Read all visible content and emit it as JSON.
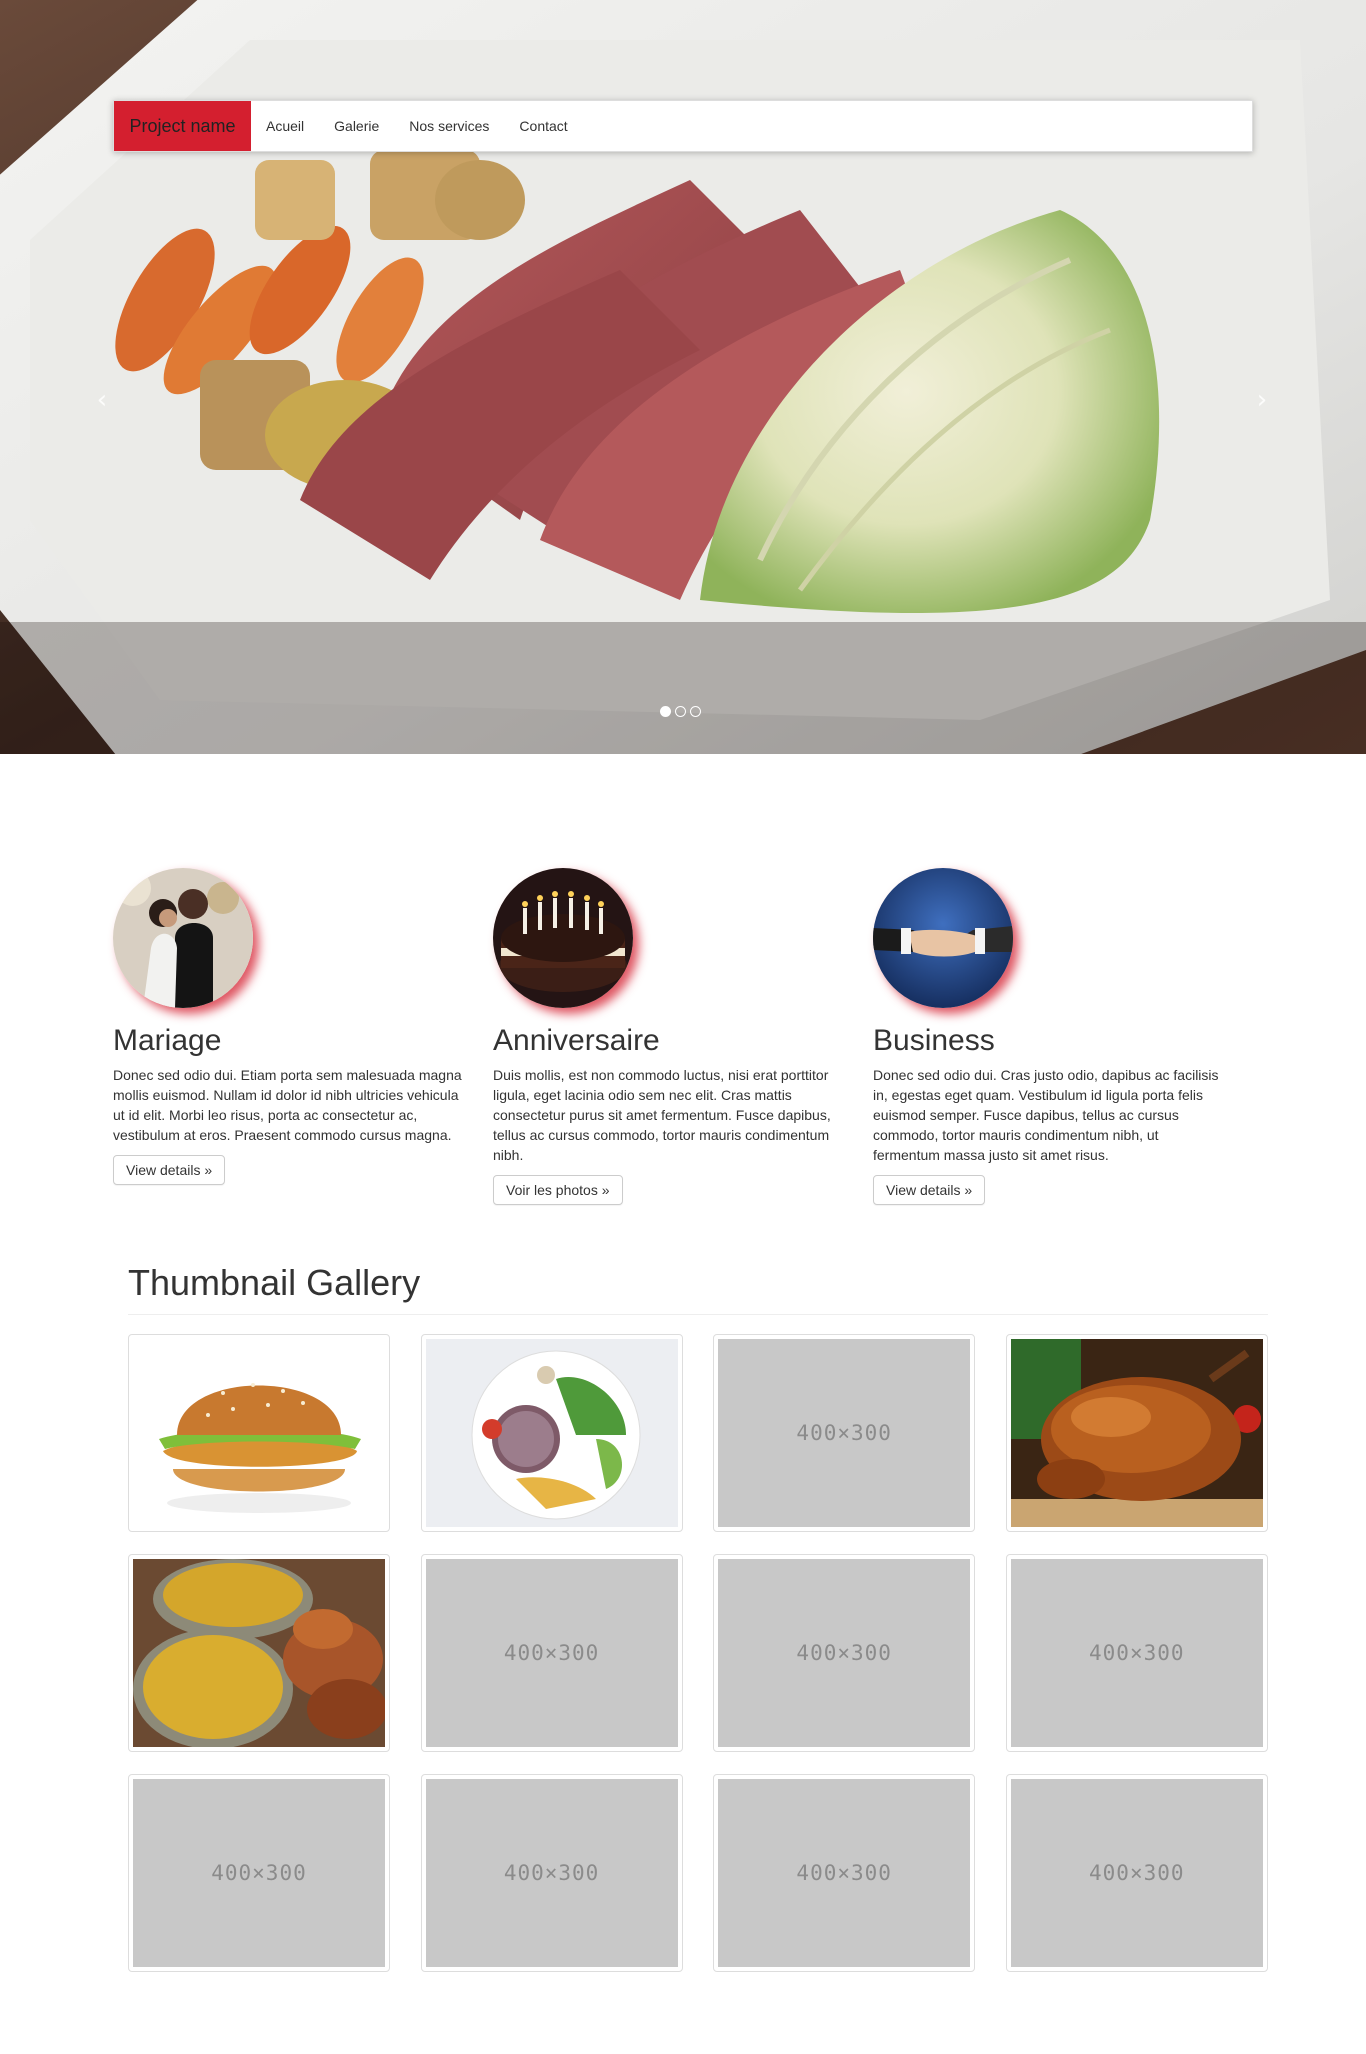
{
  "navbar": {
    "brand": "Project name",
    "items": [
      "Acueil",
      "Galerie",
      "Nos services",
      "Contact"
    ]
  },
  "carousel": {
    "prev_glyph": "‹",
    "next_glyph": "›",
    "indicator_count": 3,
    "active_index": 0
  },
  "features": [
    {
      "title": "Mariage",
      "text": "Donec sed odio dui. Etiam porta sem malesuada magna mollis euismod. Nullam id dolor id nibh ultricies vehicula ut id elit. Morbi leo risus, porta ac consectetur ac, vestibulum at eros. Praesent commodo cursus magna.",
      "button": "View details »"
    },
    {
      "title": "Anniversaire",
      "text": "Duis mollis, est non commodo luctus, nisi erat porttitor ligula, eget lacinia odio sem nec elit. Cras mattis consectetur purus sit amet fermentum. Fusce dapibus, tellus ac cursus commodo, tortor mauris condimentum nibh.",
      "button": "Voir les photos »"
    },
    {
      "title": "Business",
      "text": "Donec sed odio dui. Cras justo odio, dapibus ac facilisis in, egestas eget quam. Vestibulum id ligula porta felis euismod semper. Fusce dapibus, tellus ac cursus commodo, tortor mauris condimentum nibh, ut fermentum massa justo sit amet risus.",
      "button": "View details »"
    }
  ],
  "gallery": {
    "title": "Thumbnail Gallery",
    "placeholder_label": "400×300",
    "items": [
      "burger",
      "grilled-plate",
      "placeholder",
      "roast-chicken",
      "rice-chicken",
      "placeholder",
      "placeholder",
      "placeholder",
      "placeholder",
      "placeholder",
      "placeholder",
      "placeholder"
    ]
  },
  "colors": {
    "brand": "#d41f2f",
    "placeholder_bg": "#c8c8c8",
    "placeholder_text": "#8b8b8b"
  }
}
